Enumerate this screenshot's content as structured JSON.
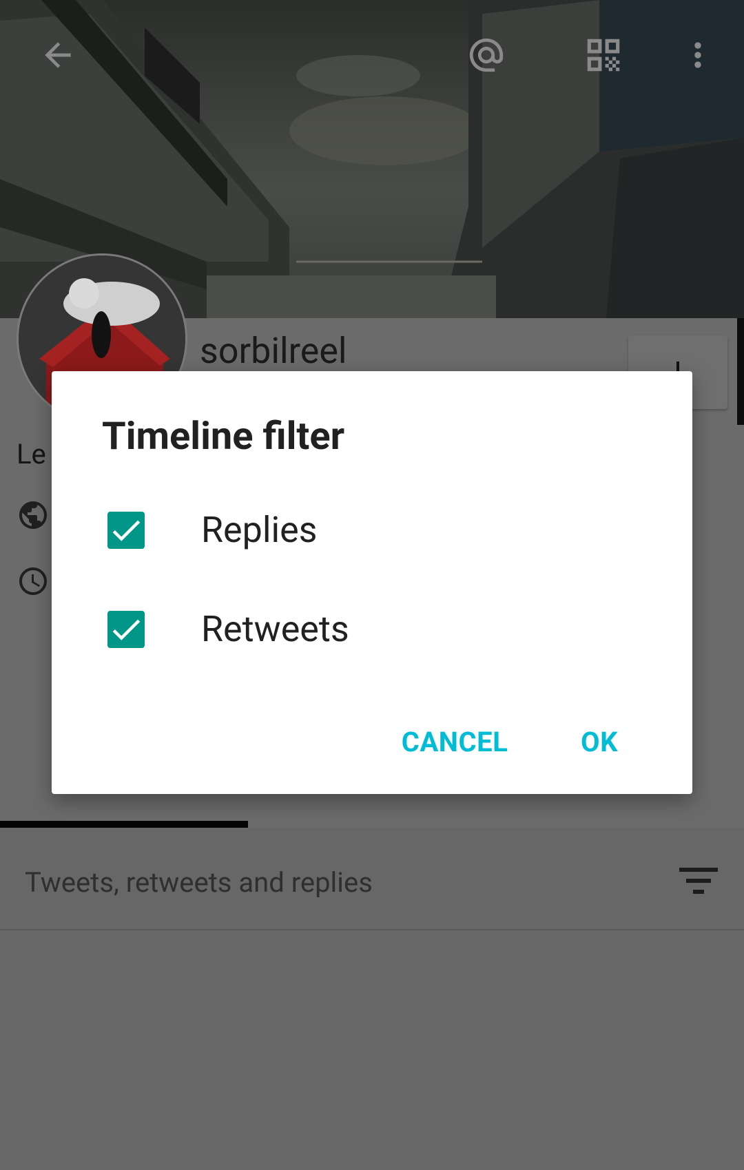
{
  "profile": {
    "username": "sorbilreel",
    "bio_partial": "Le"
  },
  "timeline": {
    "filter_label": "Tweets, retweets and replies"
  },
  "dialog": {
    "title": "Timeline filter",
    "options": [
      {
        "label": "Replies",
        "checked": true
      },
      {
        "label": "Retweets",
        "checked": true
      }
    ],
    "cancel_label": "CANCEL",
    "ok_label": "OK"
  },
  "toolbar": {
    "icons": [
      "arrow-back-icon",
      "mention-icon",
      "qr-code-icon",
      "more-vert-icon"
    ]
  },
  "colors": {
    "accent": "#00bcd4",
    "checkbox": "#009688",
    "scrim_background": "#676767"
  }
}
